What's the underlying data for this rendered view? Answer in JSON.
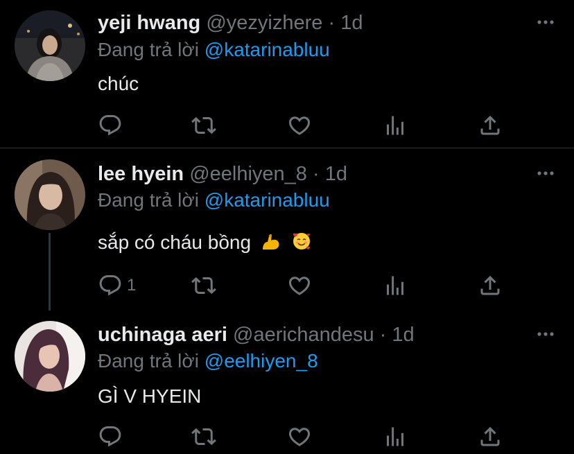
{
  "colors": {
    "background": "#000000",
    "text_primary": "#e7e9ea",
    "text_secondary": "#71767b",
    "mention": "#1d9bf0",
    "divider": "#2f3336"
  },
  "tweets": [
    {
      "name": "yeji hwang",
      "handle": "@yezyizhere",
      "separator": "·",
      "time": "1d",
      "reply_prefix": "Đang trả lời",
      "reply_mention": "@katarinabluu",
      "text": "chúc",
      "emojis": [],
      "reply_count": "",
      "icons": [
        "reply-icon",
        "retweet-icon",
        "like-icon",
        "analytics-icon",
        "share-icon"
      ]
    },
    {
      "name": "lee hyein",
      "handle": "@eelhiyen_8",
      "separator": "·",
      "time": "1d",
      "reply_prefix": "Đang trả lời",
      "reply_mention": "@katarinabluu",
      "text": "sắp có cháu bồng",
      "emojis": [
        "flexed-biceps-emoji",
        "smiling-face-with-hearts-emoji"
      ],
      "reply_count": "1",
      "icons": [
        "reply-icon",
        "retweet-icon",
        "like-icon",
        "analytics-icon",
        "share-icon"
      ]
    },
    {
      "name": "uchinaga aeri",
      "handle": "@aerichandesu",
      "separator": "·",
      "time": "1d",
      "reply_prefix": "Đang trả lời",
      "reply_mention": "@eelhiyen_8",
      "text": "GÌ V HYEIN",
      "emojis": [],
      "reply_count": "",
      "icons": [
        "reply-icon",
        "retweet-icon",
        "like-icon",
        "analytics-icon",
        "share-icon"
      ]
    }
  ]
}
